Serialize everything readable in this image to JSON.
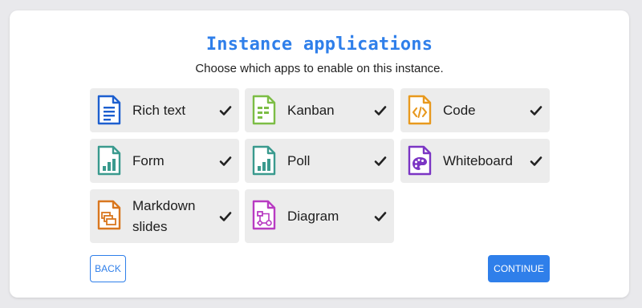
{
  "dialog": {
    "title": "Instance applications",
    "subtitle": "Choose which apps to enable on this instance."
  },
  "apps": [
    {
      "label": "Rich text",
      "icon": "rich-text-icon",
      "color": "#1d5fcf",
      "selected": true
    },
    {
      "label": "Kanban",
      "icon": "kanban-icon",
      "color": "#7cbd45",
      "selected": true
    },
    {
      "label": "Code",
      "icon": "code-icon",
      "color": "#e8991e",
      "selected": true
    },
    {
      "label": "Form",
      "icon": "form-icon",
      "color": "#3a9a8e",
      "selected": true
    },
    {
      "label": "Poll",
      "icon": "poll-icon",
      "color": "#3a9a8e",
      "selected": true
    },
    {
      "label": "Whiteboard",
      "icon": "whiteboard-icon",
      "color": "#7b35c4",
      "selected": true
    },
    {
      "label": "Markdown slides",
      "icon": "slides-icon",
      "color": "#d9771f",
      "selected": true
    },
    {
      "label": "Diagram",
      "icon": "diagram-icon",
      "color": "#b83bc2",
      "selected": true
    }
  ],
  "actions": {
    "back_label": "BACK",
    "continue_label": "CONTINUE",
    "accent": "#2f7fea"
  }
}
